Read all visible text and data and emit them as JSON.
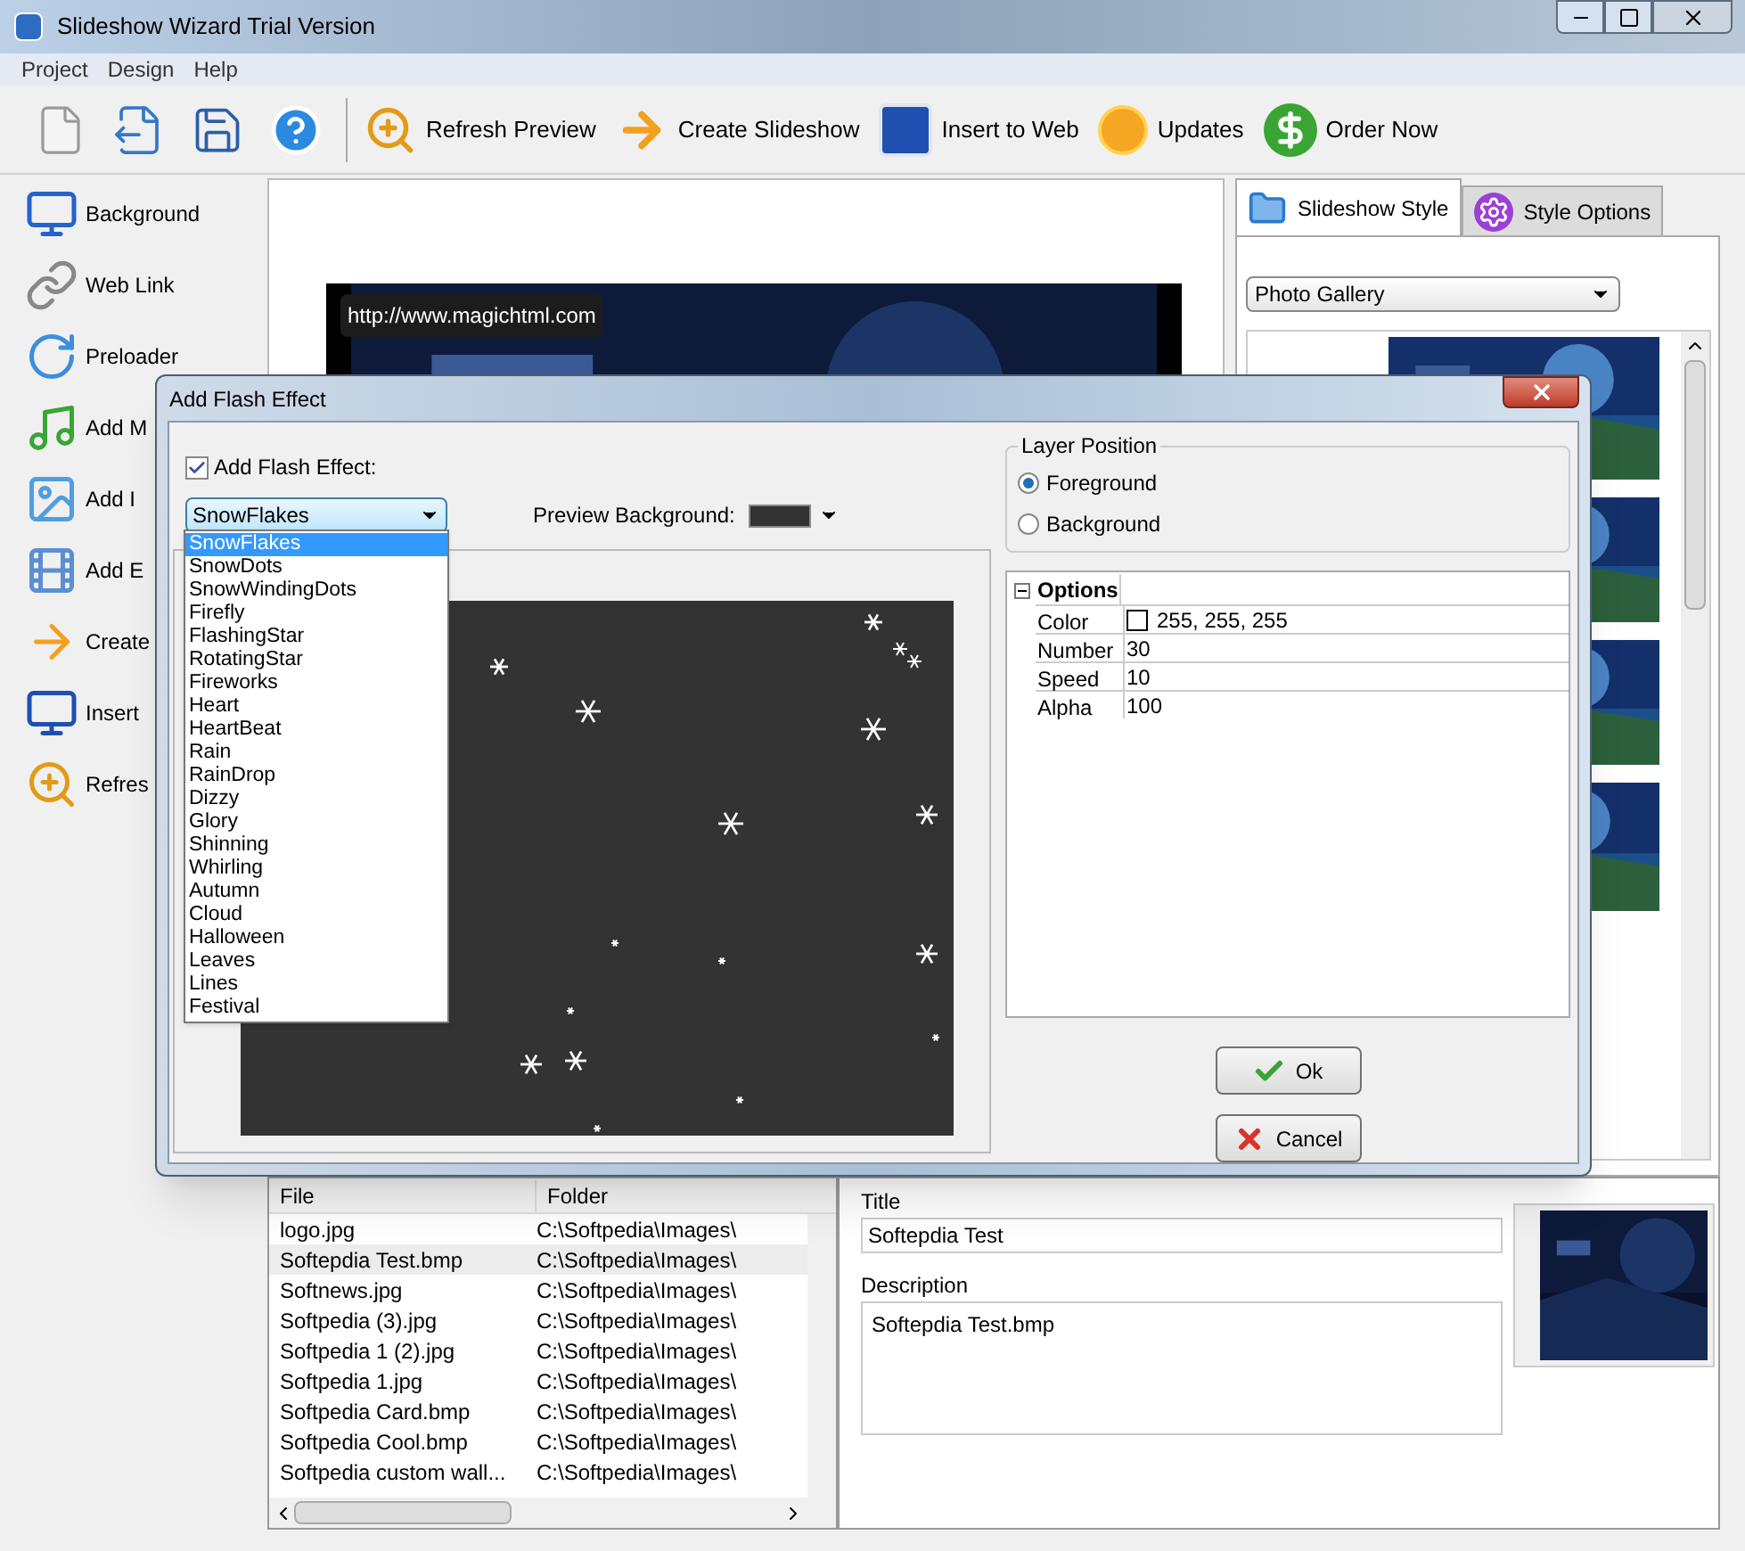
{
  "window": {
    "title": "Slideshow Wizard Trial Version"
  },
  "menu": [
    "Project",
    "Design",
    "Help"
  ],
  "toolbar": [
    {
      "label": "Refresh Preview"
    },
    {
      "label": "Create Slideshow"
    },
    {
      "label": "Insert to Web"
    },
    {
      "label": "Updates"
    },
    {
      "label": "Order Now"
    }
  ],
  "sidebar": {
    "items": [
      {
        "label": "Background"
      },
      {
        "label": "Web Link"
      },
      {
        "label": "Preloader"
      },
      {
        "label": "Add M"
      },
      {
        "label": "Add I"
      },
      {
        "label": "Add E"
      },
      {
        "label": "Create"
      },
      {
        "label": "Insert"
      },
      {
        "label": "Refres"
      }
    ]
  },
  "preview": {
    "url": "http://www.magichtml.com"
  },
  "style_panel": {
    "tabs": [
      {
        "label": "Slideshow Style",
        "selected": true
      },
      {
        "label": "Style Options",
        "selected": false
      }
    ],
    "style": "Photo Gallery"
  },
  "files": {
    "columns": [
      "File",
      "Folder"
    ],
    "rows": [
      {
        "file": "logo.jpg",
        "folder": "C:\\Softpedia\\Images\\",
        "selected": false
      },
      {
        "file": "Softepdia Test.bmp",
        "folder": "C:\\Softpedia\\Images\\",
        "selected": true
      },
      {
        "file": "Softnews.jpg",
        "folder": "C:\\Softpedia\\Images\\",
        "selected": false
      },
      {
        "file": "Softpedia (3).jpg",
        "folder": "C:\\Softpedia\\Images\\",
        "selected": false
      },
      {
        "file": "Softpedia 1 (2).jpg",
        "folder": "C:\\Softpedia\\Images\\",
        "selected": false
      },
      {
        "file": "Softpedia 1.jpg",
        "folder": "C:\\Softpedia\\Images\\",
        "selected": false
      },
      {
        "file": "Softpedia Card.bmp",
        "folder": "C:\\Softpedia\\Images\\",
        "selected": false
      },
      {
        "file": "Softpedia Cool.bmp",
        "folder": "C:\\Softpedia\\Images\\",
        "selected": false
      },
      {
        "file": "Softpedia custom wall...",
        "folder": "C:\\Softpedia\\Images\\",
        "selected": false
      }
    ]
  },
  "details": {
    "title_label": "Title",
    "title_value": "Softepdia Test",
    "description_label": "Description",
    "description_value": "Softepdia Test.bmp"
  },
  "dialog": {
    "title": "Add Flash Effect",
    "enable": {
      "label": "Add Flash Effect:",
      "checked": true
    },
    "effect": "SnowFlakes",
    "preview_background_label": "Preview Background:",
    "effect_options": [
      {
        "label": "SnowFlakes",
        "selected": true
      },
      {
        "label": "SnowDots",
        "selected": false
      },
      {
        "label": "SnowWindingDots",
        "selected": false
      },
      {
        "label": "Firefly",
        "selected": false
      },
      {
        "label": "FlashingStar",
        "selected": false
      },
      {
        "label": "RotatingStar",
        "selected": false
      },
      {
        "label": "Fireworks",
        "selected": false
      },
      {
        "label": "Heart",
        "selected": false
      },
      {
        "label": "HeartBeat",
        "selected": false
      },
      {
        "label": "Rain",
        "selected": false
      },
      {
        "label": "RainDrop",
        "selected": false
      },
      {
        "label": "Dizzy",
        "selected": false
      },
      {
        "label": "Glory",
        "selected": false
      },
      {
        "label": "Shinning",
        "selected": false
      },
      {
        "label": "Whirling",
        "selected": false
      },
      {
        "label": "Autumn",
        "selected": false
      },
      {
        "label": "Cloud",
        "selected": false
      },
      {
        "label": "Halloween",
        "selected": false
      },
      {
        "label": "Leaves",
        "selected": false
      },
      {
        "label": "Lines",
        "selected": false
      },
      {
        "label": "Festival",
        "selected": false
      }
    ],
    "layer_position": {
      "title": "Layer Position",
      "options": [
        {
          "label": "Foreground",
          "selected": true
        },
        {
          "label": "Background",
          "selected": false
        }
      ]
    },
    "options": {
      "title": "Options",
      "expanded": true,
      "rows": [
        {
          "kind": "color",
          "name": "Color",
          "value": "255, 255, 255"
        },
        {
          "kind": "text",
          "name": "Number",
          "value": "30"
        },
        {
          "kind": "text",
          "name": "Speed",
          "value": "10"
        },
        {
          "kind": "text",
          "name": "Alpha",
          "value": "100"
        }
      ]
    },
    "buttons": [
      {
        "kind": "ok",
        "label": "Ok"
      },
      {
        "kind": "cancel",
        "label": "Cancel"
      }
    ]
  }
}
